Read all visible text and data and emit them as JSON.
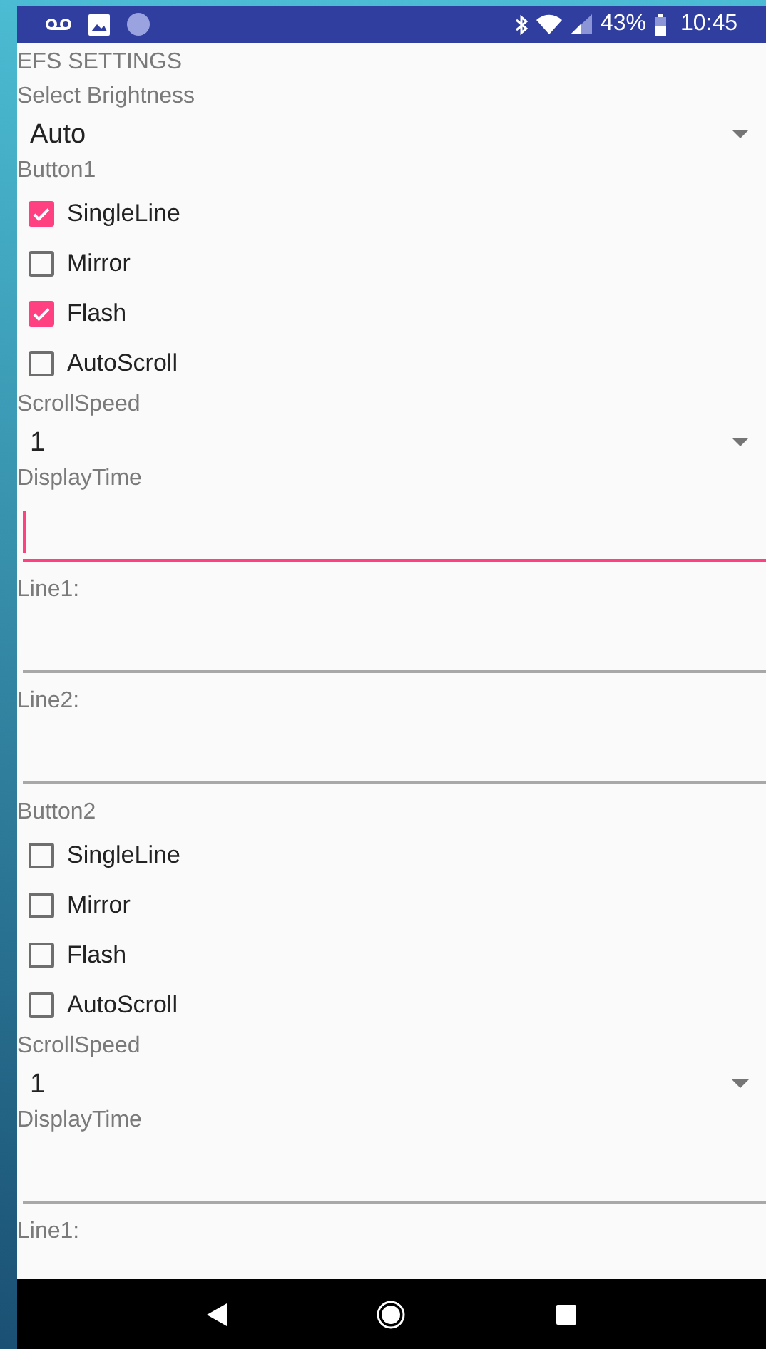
{
  "status_bar": {
    "battery": "43%",
    "time": "10:45"
  },
  "items": [
    {
      "kind": "title",
      "text": "EFS SETTINGS"
    },
    {
      "kind": "label",
      "text": "Select Brightness"
    },
    {
      "kind": "dropdown",
      "value": "Auto"
    },
    {
      "kind": "label",
      "text": "Button1"
    },
    {
      "kind": "checkbox",
      "label": "SingleLine",
      "checked": true
    },
    {
      "kind": "checkbox",
      "label": "Mirror",
      "checked": false
    },
    {
      "kind": "checkbox",
      "label": "Flash",
      "checked": true
    },
    {
      "kind": "checkbox",
      "label": "AutoScroll",
      "checked": false
    },
    {
      "kind": "label",
      "text": "ScrollSpeed"
    },
    {
      "kind": "dropdown",
      "value": "1"
    },
    {
      "kind": "label",
      "text": "DisplayTime"
    },
    {
      "kind": "field",
      "focused": true
    },
    {
      "kind": "label",
      "text": "Line1:"
    },
    {
      "kind": "field",
      "focused": false
    },
    {
      "kind": "label",
      "text": "Line2:"
    },
    {
      "kind": "field",
      "focused": false
    },
    {
      "kind": "label",
      "text": "Button2"
    },
    {
      "kind": "checkbox",
      "label": "SingleLine",
      "checked": false
    },
    {
      "kind": "checkbox",
      "label": "Mirror",
      "checked": false
    },
    {
      "kind": "checkbox",
      "label": "Flash",
      "checked": false
    },
    {
      "kind": "checkbox",
      "label": "AutoScroll",
      "checked": false
    },
    {
      "kind": "label",
      "text": "ScrollSpeed"
    },
    {
      "kind": "dropdown",
      "value": "1"
    },
    {
      "kind": "label",
      "text": "DisplayTime"
    },
    {
      "kind": "field",
      "focused": false
    },
    {
      "kind": "label",
      "text": "Line1:"
    }
  ]
}
